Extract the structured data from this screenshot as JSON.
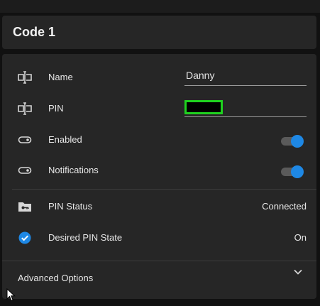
{
  "header": {
    "title": "Code 1"
  },
  "fields": {
    "name": {
      "label": "Name",
      "value": "Danny",
      "icon": "textbox-icon"
    },
    "pin": {
      "label": "PIN",
      "value": "",
      "icon": "textbox-icon"
    }
  },
  "toggles": {
    "enabled": {
      "label": "Enabled",
      "state": "on",
      "icon": "toggle-switch-icon"
    },
    "notifications": {
      "label": "Notifications",
      "state": "on",
      "icon": "toggle-switch-icon"
    }
  },
  "status": {
    "pin_status": {
      "label": "PIN Status",
      "value": "Connected",
      "icon": "folder-key-icon"
    },
    "desired_pin_state": {
      "label": "Desired PIN State",
      "value": "On",
      "icon": "check-circle-icon"
    }
  },
  "advanced": {
    "label": "Advanced Options",
    "icon": "chevron-down-icon"
  },
  "colors": {
    "accent": "#1e88e5",
    "card": "#262626",
    "background": "#111111",
    "pin_highlight": "#1fd11f"
  }
}
